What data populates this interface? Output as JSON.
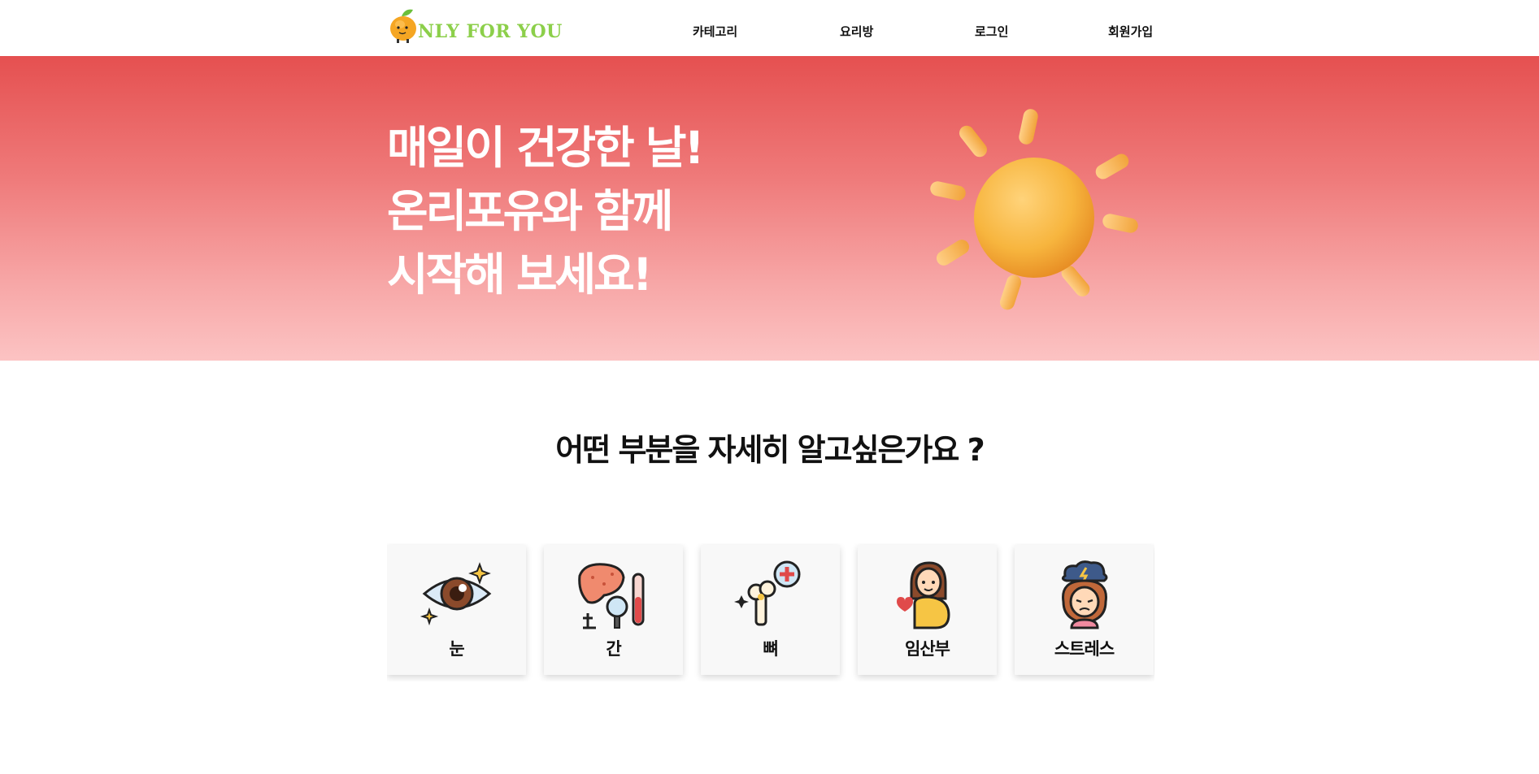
{
  "header": {
    "logo_text": "NLY FOR YOU",
    "nav": [
      {
        "label": "카테고리"
      },
      {
        "label": "요리방"
      },
      {
        "label": "로그인"
      },
      {
        "label": "회원가입"
      }
    ]
  },
  "hero": {
    "lines": [
      "매일이 건강한 날!",
      "온리포유와 함께",
      "시작해 보세요!"
    ],
    "icon": "sun-icon"
  },
  "section": {
    "title": "어떤 부분을 자세히 알고싶은가요 ?"
  },
  "categories": [
    {
      "label": "눈",
      "icon": "eye-icon"
    },
    {
      "label": "간",
      "icon": "liver-icon"
    },
    {
      "label": "뼈",
      "icon": "bone-icon"
    },
    {
      "label": "임산부",
      "icon": "pregnant-woman-icon"
    },
    {
      "label": "스트레스",
      "icon": "stress-icon"
    }
  ],
  "colors": {
    "hero_top": "#e55050",
    "hero_bottom": "#fcc3c3",
    "logo_green": "#8ccf4a",
    "card_bg": "#f8f8f8"
  }
}
